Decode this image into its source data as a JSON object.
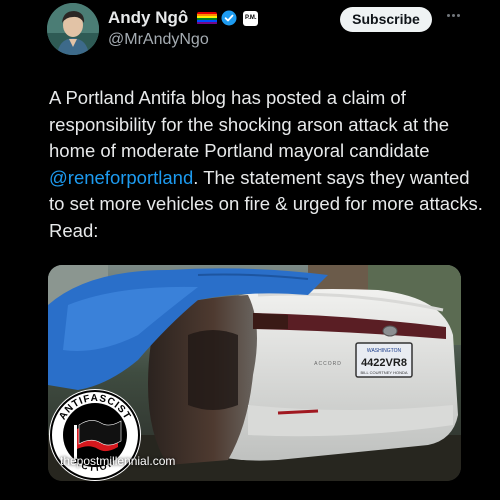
{
  "author": {
    "display_name": "Andy Ngô",
    "handle": "@MrAndyNgo",
    "affiliate_badge": "P.M.",
    "verified": true,
    "icons": [
      "avatar",
      "rainbow-flag-icon",
      "verified-badge-icon",
      "affiliate-badge-icon"
    ]
  },
  "actions": {
    "subscribe_label": "Subscribe",
    "more_icon": "more-horizontal-icon"
  },
  "tweet": {
    "text_before": "A Portland Antifa blog has posted a claim of responsibility for the shocking arson attack at the home of moderate Portland mayoral candidate ",
    "mention": "@reneforportland",
    "text_after": ". The statement says they wanted to set more vehicles on fire & urged for more attacks. Read:"
  },
  "media": {
    "plate_state": "WASHINGTON",
    "plate_number": "4422VR8",
    "plate_frame": "BILL COURTNEY HONDA",
    "car_model": "ACCORD",
    "logo_text_top": "ANTIFASCIST",
    "logo_text_bottom": "ACTION",
    "watermark": "thepostmillennial.com"
  },
  "colors": {
    "background": "#000000",
    "text": "#e7e9ea",
    "secondary_text": "#a5acb2",
    "link": "#1d9bf0",
    "subscribe_bg": "#eff3f4",
    "antifa_red": "#d5181e"
  }
}
